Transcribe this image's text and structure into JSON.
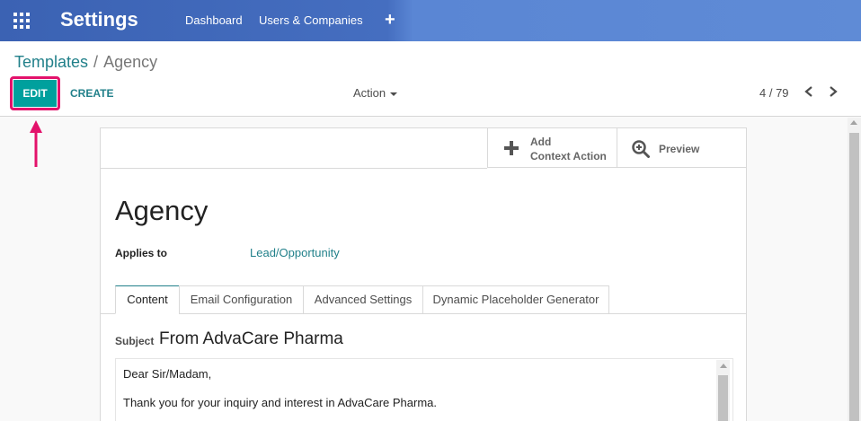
{
  "navbar": {
    "app_title": "Settings",
    "menu": [
      "Dashboard",
      "Users & Companies"
    ],
    "add_icon": "plus-icon",
    "apps_icon": "grid-icon"
  },
  "breadcrumb": {
    "parent": "Templates",
    "separator": "/",
    "current": "Agency"
  },
  "toolbar": {
    "edit_label": "EDIT",
    "create_label": "CREATE",
    "action_label": "Action",
    "pager": "4 / 79"
  },
  "form": {
    "buttons": {
      "context_action_line1": "Add",
      "context_action_line2": "Context Action",
      "preview_label": "Preview"
    },
    "title": "Agency",
    "applies_to_label": "Applies to",
    "applies_to_value": "Lead/Opportunity",
    "tabs": [
      "Content",
      "Email Configuration",
      "Advanced Settings",
      "Dynamic Placeholder Generator"
    ],
    "active_tab": "Content",
    "subject_label": "Subject",
    "subject_value": "From AdvaCare Pharma",
    "body_lines": [
      "Dear Sir/Madam,",
      "Thank you for your inquiry and interest in AdvaCare Pharma."
    ]
  },
  "colors": {
    "accent": "#00a09d",
    "link": "#21808a",
    "navbar": "#456ec0",
    "annotation": "#e3126b"
  }
}
